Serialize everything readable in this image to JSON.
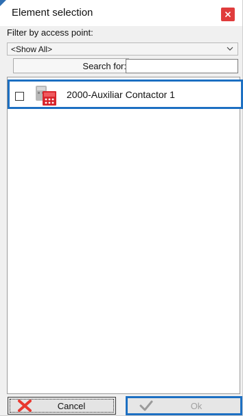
{
  "dialog": {
    "title": "Element selection",
    "close_icon": "close-icon",
    "accent_color": "#1c6fc2",
    "close_color": "#e03c3c"
  },
  "filter": {
    "label": "Filter by access point:",
    "selected": "<Show All>"
  },
  "search": {
    "label": "Search for:",
    "value": ""
  },
  "list": {
    "items": [
      {
        "label": "2000-Auxiliar Contactor 1",
        "checked": false,
        "icon": "contactor-icon"
      }
    ]
  },
  "buttons": {
    "cancel_label": "Cancel",
    "cancel_icon": "x-icon",
    "ok_label": "Ok",
    "ok_icon": "checkmark-icon",
    "ok_enabled": false
  }
}
